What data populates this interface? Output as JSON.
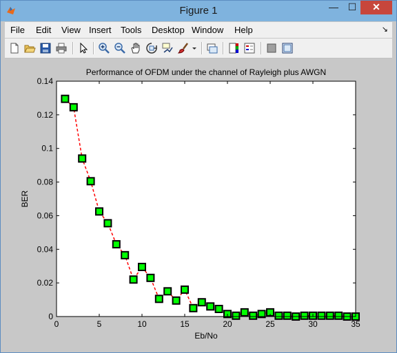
{
  "window": {
    "title": "Figure 1",
    "minimize_glyph": "—",
    "maximize_glyph": "☐",
    "close_glyph": "✕"
  },
  "menu": [
    "File",
    "Edit",
    "View",
    "Insert",
    "Tools",
    "Desktop",
    "Window",
    "Help"
  ],
  "toolbar_icons": [
    "new-figure-icon",
    "open-file-icon",
    "save-icon",
    "print-icon",
    "pointer-icon",
    "zoom-in-icon",
    "zoom-out-icon",
    "pan-icon",
    "rotate-3d-icon",
    "data-cursor-icon",
    "brush-icon",
    "brush-menu-chevron-icon",
    "link-plot-icon",
    "colorbar-icon",
    "legend-icon",
    "hide-plot-tools-icon",
    "show-plot-tools-icon"
  ],
  "chart_data": {
    "type": "line",
    "title": "Performance of OFDM under the channel of Rayleigh plus AWGN",
    "xlabel": "Eb/No",
    "ylabel": "BER",
    "xlim": [
      0,
      35
    ],
    "ylim": [
      0,
      0.14
    ],
    "xticks": [
      "0",
      "5",
      "10",
      "15",
      "20",
      "25",
      "30",
      "35"
    ],
    "yticks": [
      "0",
      "0.02",
      "0.04",
      "0.06",
      "0.08",
      "0.1",
      "0.12",
      "0.14"
    ],
    "grid": false,
    "line_color": "#ff0000",
    "line_style": "dashed",
    "marker": "square",
    "marker_face": "#00ff00",
    "marker_edge": "#000000",
    "x": [
      1,
      2,
      3,
      4,
      5,
      6,
      7,
      8,
      9,
      10,
      11,
      12,
      13,
      14,
      15,
      16,
      17,
      18,
      19,
      20,
      21,
      22,
      23,
      24,
      25,
      26,
      27,
      28,
      29,
      30,
      31,
      32,
      33,
      34,
      35
    ],
    "y": [
      0.1295,
      0.1245,
      0.094,
      0.0805,
      0.0625,
      0.0555,
      0.043,
      0.0365,
      0.022,
      0.0295,
      0.023,
      0.0105,
      0.015,
      0.0095,
      0.016,
      0.005,
      0.0085,
      0.006,
      0.0045,
      0.0015,
      0.0005,
      0.0025,
      0.0005,
      0.0015,
      0.0025,
      0.0005,
      0.0005,
      0.0,
      0.0005,
      0.0005,
      0.0005,
      0.0005,
      0.0005,
      0.0,
      0.0
    ]
  }
}
